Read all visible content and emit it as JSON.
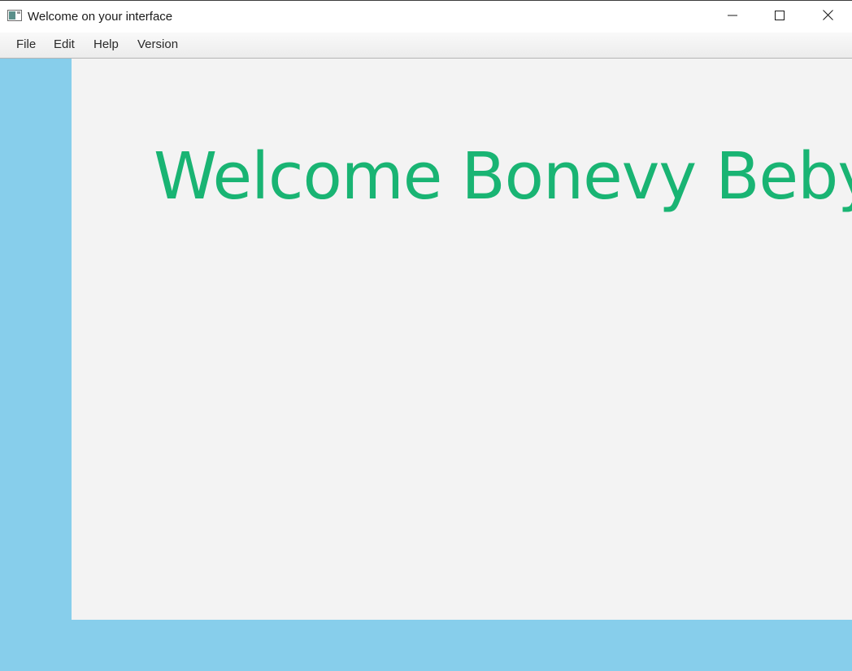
{
  "window": {
    "title": "Welcome on your interface",
    "icon": "app-window-icon",
    "controls": {
      "minimize_icon": "minimize-icon",
      "maximize_icon": "maximize-icon",
      "close_icon": "close-icon"
    }
  },
  "menubar": {
    "items": [
      {
        "label": "File"
      },
      {
        "label": "Edit"
      },
      {
        "label": "Help"
      },
      {
        "label": "Version"
      }
    ]
  },
  "main": {
    "welcome_text": "Welcome Bonevy Beby"
  },
  "colors": {
    "side_panel": "#87ceeb",
    "content_bg": "#f3f3f3",
    "welcome_text": "#19b473"
  }
}
